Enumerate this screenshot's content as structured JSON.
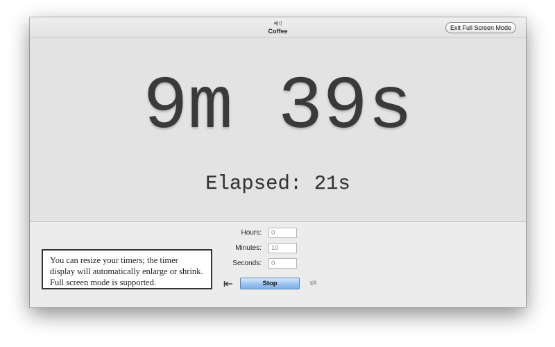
{
  "window": {
    "title": "Coffee",
    "exit_fullscreen_label": "Exit Full Screen Mode"
  },
  "timer": {
    "remaining": "9m 39s",
    "elapsed": "Elapsed: 21s"
  },
  "info": {
    "text": "You can resize your timers; the timer display will automatically enlarge or shrink. Full screen mode is supported."
  },
  "fields": {
    "hours_label": "Hours:",
    "hours_value": "0",
    "minutes_label": "Minutes:",
    "minutes_value": "10",
    "seconds_label": "Seconds:",
    "seconds_value": "0"
  },
  "buttons": {
    "stop_label": "Stop"
  },
  "icons": {
    "title": "speaker-icon",
    "reset": "rewind-icon",
    "repeat": "repeat-icon"
  },
  "colors": {
    "stop_button": "#9cc4f0",
    "display_background": "#e3e3e3"
  }
}
